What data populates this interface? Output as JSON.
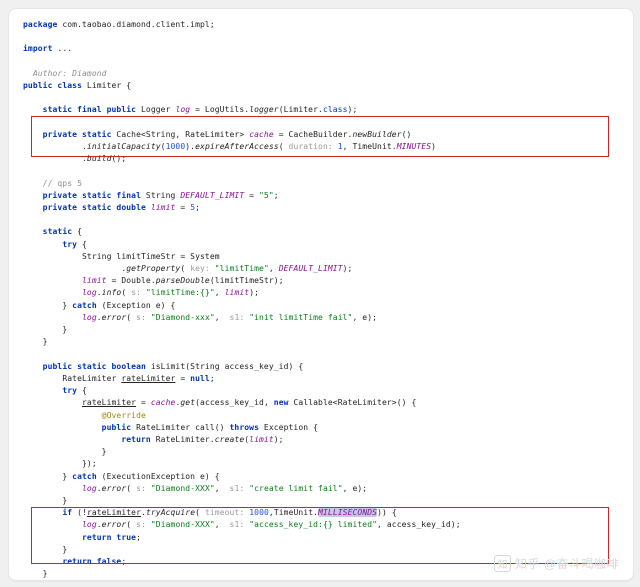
{
  "code": {
    "l1": "package com.taobao.diamond.client.impl;",
    "l2": "import ...",
    "author": "Author: Diamond",
    "l3": "public class Limiter {",
    "l4": "    static final public Logger log = LogUtils.logger(Limiter.class);",
    "l5": "    private static Cache<String, RateLimiter> cache = CacheBuilder.newBuilder()",
    "l6": "            .initialCapacity(1000).expireAfterAccess( duration: 1, TimeUnit.MINUTES)",
    "l7": "            .build();",
    "l8": "    // qps 5",
    "l9": "    private static final String DEFAULT_LIMIT = \"5\";",
    "l10": "    private static double limit = 5;",
    "l11": "    static {",
    "l12": "        try {",
    "l13": "            String limitTimeStr = System",
    "l14": "                    .getProperty( key: \"limitTime\", DEFAULT_LIMIT);",
    "l15": "            limit = Double.parseDouble(limitTimeStr);",
    "l16": "            log.info( s: \"limitTime:{}\", limit);",
    "l17": "        } catch (Exception e) {",
    "l18": "            log.error( s: \"Diamond-xxx\",  s1: \"init limitTime fail\", e);",
    "l19": "        }",
    "l20": "    }",
    "l21": "    public static boolean isLimit(String access_key_id) {",
    "l22": "        RateLimiter rateLimiter = null;",
    "l23": "        try {",
    "l24": "            rateLimiter = cache.get(access_key_id, new Callable<RateLimiter>() {",
    "l25": "                @Override",
    "l26": "                public RateLimiter call() throws Exception {",
    "l27": "                    return RateLimiter.create(limit);",
    "l28": "                }",
    "l29": "            });",
    "l30": "        } catch (ExecutionException e) {",
    "l31": "            log.error( s: \"Diamond-XXX\",  s1: \"create limit fail\", e);",
    "l32": "        }",
    "l33": "        if (!rateLimiter.tryAcquire( timeout: 1000,TimeUnit.MILLISECONDS)) {",
    "l34": "            log.error( s: \"Diamond-XXX\",  s1: \"access_key_id:{} limited\", access_key_id);",
    "l35": "            return true;",
    "l36": "        }",
    "l37": "        return false;",
    "l38": "    }"
  },
  "watermark": "知乎 @奋斗喝咖啡"
}
